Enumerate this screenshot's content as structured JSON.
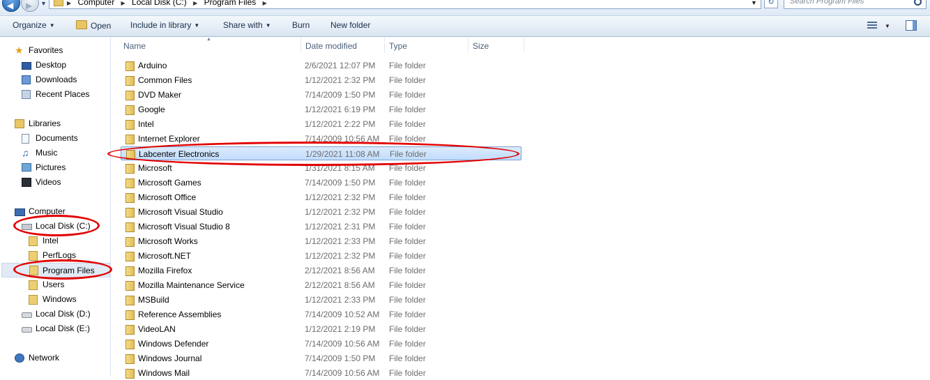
{
  "address_bar": {
    "breadcrumbs": [
      "Computer",
      "Local Disk (C:)",
      "Program Files"
    ],
    "search_placeholder": "Search Program Files"
  },
  "toolbar": {
    "organize": "Organize",
    "open": "Open",
    "include_in_library": "Include in library",
    "share_with": "Share with",
    "burn": "Burn",
    "new_folder": "New folder"
  },
  "nav": {
    "favorites": "Favorites",
    "desktop": "Desktop",
    "downloads": "Downloads",
    "recent_places": "Recent Places",
    "libraries": "Libraries",
    "documents": "Documents",
    "music": "Music",
    "pictures": "Pictures",
    "videos": "Videos",
    "computer": "Computer",
    "local_disk_c": "Local Disk (C:)",
    "intel": "Intel",
    "perflogs": "PerfLogs",
    "program_files": "Program Files",
    "users": "Users",
    "windows": "Windows",
    "local_disk_d": "Local Disk (D:)",
    "local_disk_e": "Local Disk (E:)",
    "network": "Network"
  },
  "columns": {
    "name": "Name",
    "date_modified": "Date modified",
    "type": "Type",
    "size": "Size"
  },
  "files": [
    {
      "name": "Arduino",
      "date": "2/6/2021 12:07 PM",
      "type": "File folder"
    },
    {
      "name": "Common Files",
      "date": "1/12/2021 2:32 PM",
      "type": "File folder"
    },
    {
      "name": "DVD Maker",
      "date": "7/14/2009 1:50 PM",
      "type": "File folder"
    },
    {
      "name": "Google",
      "date": "1/12/2021 6:19 PM",
      "type": "File folder"
    },
    {
      "name": "Intel",
      "date": "1/12/2021 2:22 PM",
      "type": "File folder"
    },
    {
      "name": "Internet Explorer",
      "date": "7/14/2009 10:56 AM",
      "type": "File folder"
    },
    {
      "name": "Labcenter Electronics",
      "date": "1/29/2021 11:08 AM",
      "type": "File folder",
      "selected": true
    },
    {
      "name": "Microsoft",
      "date": "1/31/2021 8:15 AM",
      "type": "File folder"
    },
    {
      "name": "Microsoft Games",
      "date": "7/14/2009 1:50 PM",
      "type": "File folder"
    },
    {
      "name": "Microsoft Office",
      "date": "1/12/2021 2:32 PM",
      "type": "File folder"
    },
    {
      "name": "Microsoft Visual Studio",
      "date": "1/12/2021 2:32 PM",
      "type": "File folder"
    },
    {
      "name": "Microsoft Visual Studio 8",
      "date": "1/12/2021 2:31 PM",
      "type": "File folder"
    },
    {
      "name": "Microsoft Works",
      "date": "1/12/2021 2:33 PM",
      "type": "File folder"
    },
    {
      "name": "Microsoft.NET",
      "date": "1/12/2021 2:32 PM",
      "type": "File folder"
    },
    {
      "name": "Mozilla Firefox",
      "date": "2/12/2021 8:56 AM",
      "type": "File folder"
    },
    {
      "name": "Mozilla Maintenance Service",
      "date": "2/12/2021 8:56 AM",
      "type": "File folder"
    },
    {
      "name": "MSBuild",
      "date": "1/12/2021 2:33 PM",
      "type": "File folder"
    },
    {
      "name": "Reference Assemblies",
      "date": "7/14/2009 10:52 AM",
      "type": "File folder"
    },
    {
      "name": "VideoLAN",
      "date": "1/12/2021 2:19 PM",
      "type": "File folder"
    },
    {
      "name": "Windows Defender",
      "date": "7/14/2009 10:56 AM",
      "type": "File folder"
    },
    {
      "name": "Windows Journal",
      "date": "7/14/2009 1:50 PM",
      "type": "File folder"
    },
    {
      "name": "Windows Mail",
      "date": "7/14/2009 10:56 AM",
      "type": "File folder"
    }
  ]
}
